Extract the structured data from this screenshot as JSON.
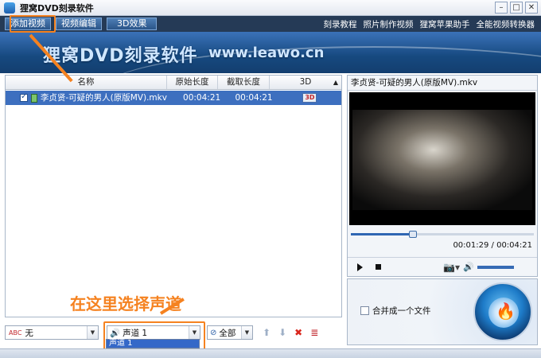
{
  "window": {
    "title": "狸窝DVD刻录软件",
    "min": "–",
    "max": "□",
    "close": "✕"
  },
  "toolbar": {
    "add_video": "添加视频",
    "edit_video": "视频编辑",
    "effect_3d": "3D效果",
    "links": [
      "刻录教程",
      "照片制作视频",
      "狸窝苹果助手",
      "全能视频转换器"
    ]
  },
  "banner": {
    "title": "狸窝DVD刻录软件",
    "url": "www.leawo.cn"
  },
  "table": {
    "headers": [
      "名称",
      "原始长度",
      "截取长度",
      "3D"
    ],
    "rows": [
      {
        "name": "李贞贤-可疑的男人(原版MV).mkv",
        "orig_len": "00:04:21",
        "clip_len": "00:04:21",
        "td": "3D"
      }
    ]
  },
  "preview": {
    "filename": "李贞贤-可疑的男人(原版MV).mkv",
    "time": "00:01:29 / 00:04:21",
    "progress": 0.34,
    "volume": 0.95
  },
  "burn": {
    "merge_label": "合并成一个文件"
  },
  "bottom": {
    "subtitle_select": "无",
    "audio_select": "声道 1",
    "audio_options": [
      "声道 1"
    ],
    "range_select": "全部"
  },
  "annotation": {
    "text": "在这里选择声道"
  },
  "colors": {
    "accent": "#f58220",
    "selection": "#3d6fbf",
    "banner": "#16497f"
  }
}
